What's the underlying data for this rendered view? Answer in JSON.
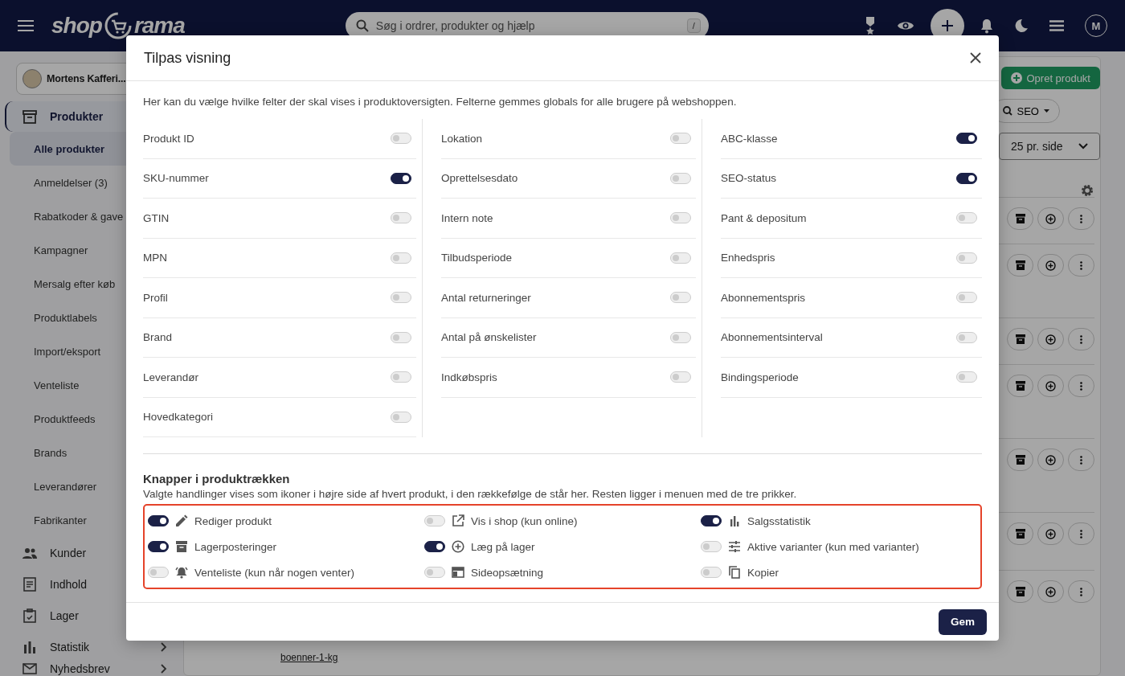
{
  "topbar": {
    "logo_left": "shop",
    "logo_right": "rama",
    "search": {
      "placeholder": "Søg i ordrer, produkter og hjælp",
      "shortcut": "/"
    },
    "avatar": "M"
  },
  "sidebar": {
    "store": "Mortens Kafferi...",
    "sections": [
      {
        "label": "Produkter",
        "kind": "box",
        "selected": true,
        "children": [
          {
            "label": "Alle produkter",
            "selected": true
          },
          {
            "label": "Anmeldelser (3)",
            "selected": false
          },
          {
            "label": "Rabatkoder & gave",
            "selected": false
          },
          {
            "label": "Kampagner",
            "selected": false
          },
          {
            "label": "Mersalg efter køb",
            "selected": false
          },
          {
            "label": "Produktlabels",
            "selected": false
          },
          {
            "label": "Import/eksport",
            "selected": false
          },
          {
            "label": "Venteliste",
            "selected": false
          },
          {
            "label": "Produktfeeds",
            "selected": false
          },
          {
            "label": "Brands",
            "selected": false
          },
          {
            "label": "Leverandører",
            "selected": false
          },
          {
            "label": "Fabrikanter",
            "selected": false
          }
        ]
      },
      {
        "label": "Kunder",
        "kind": "people",
        "selected": false
      },
      {
        "label": "Indhold",
        "kind": "doc",
        "selected": false
      },
      {
        "label": "Lager",
        "kind": "clipboard",
        "selected": false
      },
      {
        "label": "Statistik",
        "kind": "chart",
        "selected": false,
        "has_chevron": true
      },
      {
        "label": "Nyhedsbrev",
        "kind": "mail",
        "selected": false,
        "has_chevron": true
      }
    ]
  },
  "main": {
    "create_button": "Opret produkt",
    "seo_filter": "SEO",
    "page_size": "25 pr. side",
    "link_text": "boenner-1-kg"
  },
  "dialog": {
    "title": "Tilpas visning",
    "intro": "Her kan du vælge hvilke felter der skal vises i produktoversigten. Felterne gemmes globals for alle brugere på webshoppen.",
    "field_columns": [
      [
        {
          "label": "Produkt ID",
          "on": false
        },
        {
          "label": "SKU-nummer",
          "on": true
        },
        {
          "label": "GTIN",
          "on": false
        },
        {
          "label": "MPN",
          "on": false
        },
        {
          "label": "Profil",
          "on": false
        },
        {
          "label": "Brand",
          "on": false
        },
        {
          "label": "Leverandør",
          "on": false
        },
        {
          "label": "Hovedkategori",
          "on": false
        }
      ],
      [
        {
          "label": "Lokation",
          "on": false
        },
        {
          "label": "Oprettelsesdato",
          "on": false
        },
        {
          "label": "Intern note",
          "on": false
        },
        {
          "label": "Tilbudsperiode",
          "on": false
        },
        {
          "label": "Antal returneringer",
          "on": false
        },
        {
          "label": "Antal på ønskelister",
          "on": false
        },
        {
          "label": "Indkøbspris",
          "on": false
        }
      ],
      [
        {
          "label": "ABC-klasse",
          "on": true
        },
        {
          "label": "SEO-status",
          "on": true
        },
        {
          "label": "Pant & depositum",
          "on": false
        },
        {
          "label": "Enhedspris",
          "on": false
        },
        {
          "label": "Abonnementspris",
          "on": false
        },
        {
          "label": "Abonnementsinterval",
          "on": false
        },
        {
          "label": "Bindingsperiode",
          "on": false
        }
      ]
    ],
    "actions_title": "Knapper i produktrækken",
    "actions_description": "Valgte handlinger vises som ikoner i højre side af hvert produkt, i den rækkefølge de står her. Resten ligger i menuen med de tre prikker.",
    "action_columns": [
      [
        {
          "label": "Rediger produkt",
          "on": true,
          "kind": "pencil"
        },
        {
          "label": "Lagerposteringer",
          "on": true,
          "kind": "archive"
        },
        {
          "label": "Venteliste (kun når nogen venter)",
          "on": false,
          "kind": "bell"
        }
      ],
      [
        {
          "label": "Vis i shop (kun online)",
          "on": false,
          "kind": "external"
        },
        {
          "label": "Læg på lager",
          "on": true,
          "kind": "plus"
        },
        {
          "label": "Sideopsætning",
          "on": false,
          "kind": "layout"
        }
      ],
      [
        {
          "label": "Salgsstatistik",
          "on": true,
          "kind": "chart"
        },
        {
          "label": "Aktive varianter (kun med varianter)",
          "on": false,
          "kind": "sliders"
        },
        {
          "label": "Kopier",
          "on": false,
          "kind": "copy"
        }
      ]
    ],
    "save_button": "Gem"
  }
}
